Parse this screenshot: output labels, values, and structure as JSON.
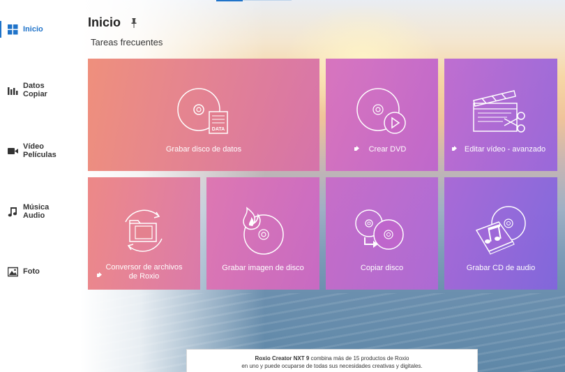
{
  "header": {
    "title": "Inicio",
    "section": "Tareas frecuentes"
  },
  "sidebar": {
    "items": [
      {
        "label": "Inicio",
        "icon": "home-grid-icon",
        "active": true
      },
      {
        "label": "Datos\nCopiar",
        "icon": "bar-chart-icon"
      },
      {
        "label": "Vídeo\nPelículas",
        "icon": "video-camera-icon"
      },
      {
        "label": "Música\nAudio",
        "icon": "music-note-icon"
      },
      {
        "label": "Foto",
        "icon": "photo-icon"
      }
    ]
  },
  "tiles": [
    {
      "label": "Grabar disco de datos",
      "icon": "data-disc-icon",
      "badge": false
    },
    {
      "label": "Crear DVD",
      "icon": "dvd-play-icon",
      "badge": true
    },
    {
      "label": "Editar vídeo - avanzado",
      "icon": "clapperboard-scissors-icon",
      "badge": true
    },
    {
      "label": "Conversor de archivos\nde Roxio",
      "icon": "folder-convert-icon",
      "badge": true
    },
    {
      "label": "Grabar imagen de disco",
      "icon": "burn-image-icon",
      "badge": false
    },
    {
      "label": "Copiar disco",
      "icon": "copy-disc-icon",
      "badge": false
    },
    {
      "label": "Grabar CD de audio",
      "icon": "audio-cd-icon",
      "badge": false
    }
  ],
  "data_disc_doc_text": [
    "DATA"
  ],
  "promo": {
    "brand": "Roxio Creator NXT 9",
    "line1_rest": " combina más de 15 productos de Roxio",
    "line2": "en uno y puede ocuparse de todas sus necesidades creativas y digitales."
  },
  "colors": {
    "accent": "#1f73c9",
    "tile_gradient_start": "#ee8a7a",
    "tile_gradient_end": "#8f6ad8"
  }
}
